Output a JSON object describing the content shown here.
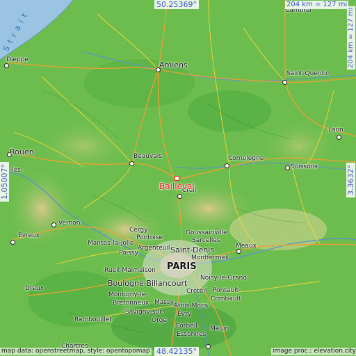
{
  "coords": {
    "top_lat": "50.25369°",
    "bottom_lat": "48.42135°",
    "left_lon": "1.05007°",
    "right_lon": "3.3632°"
  },
  "scale": {
    "horizontal": "204 km = 127 mi",
    "vertical": "204 km = 127 mi"
  },
  "sea_label": "Strait",
  "target": {
    "name": "Bailleval"
  },
  "cities": {
    "cambrai": "Cambrai",
    "dieppe": "Dieppe",
    "amiens": "Amiens",
    "saint_quentin": "Saint-Quentin",
    "laon": "Laon",
    "rouen": "Rouen",
    "les": "-les-",
    "beauvais": "Beauvais",
    "compiegne": "Compiègne",
    "soissons": "Soissons",
    "creil": "Creil",
    "vernon": "Vernon",
    "evreux": "Evreux",
    "cergy": "Cergy",
    "goussainville": "Goussainville",
    "pontoise": "Pontoise",
    "mantes": "Mantes-la-Jolie",
    "sarcelles": "Sarcelles",
    "argenteuil": "Argenteuil",
    "poissy": "Poissy",
    "saint_denis": "Saint-Denis",
    "meaux": "Meaux",
    "montfermeil": "Montfermeil",
    "rueil": "Rueil-Malmaison",
    "paris": "PARIS",
    "boulogne": "Boulogne-Billancourt",
    "noisy": "Noisy-le-Grand",
    "dreux": "Dreux",
    "montigny": "Montigny-le-",
    "bretonneux": "Bretonneux",
    "creteil": "Créteil",
    "pontault": "Pontault-",
    "combault": "Combault",
    "massy": "Massy",
    "athis": "Athis-Mons",
    "savigny": "Savigny-sur-",
    "orge": "Orge",
    "evry": "Évry",
    "rambouillet": "Rambouillet",
    "corbeil": "Corbeil-",
    "essonnes": "Essonnes",
    "melun": "Melun",
    "chartres": "Chartres"
  },
  "credits": {
    "left": "map data: openstreetmap, style: opentopomap",
    "right": "image proc.: elevation.city"
  }
}
